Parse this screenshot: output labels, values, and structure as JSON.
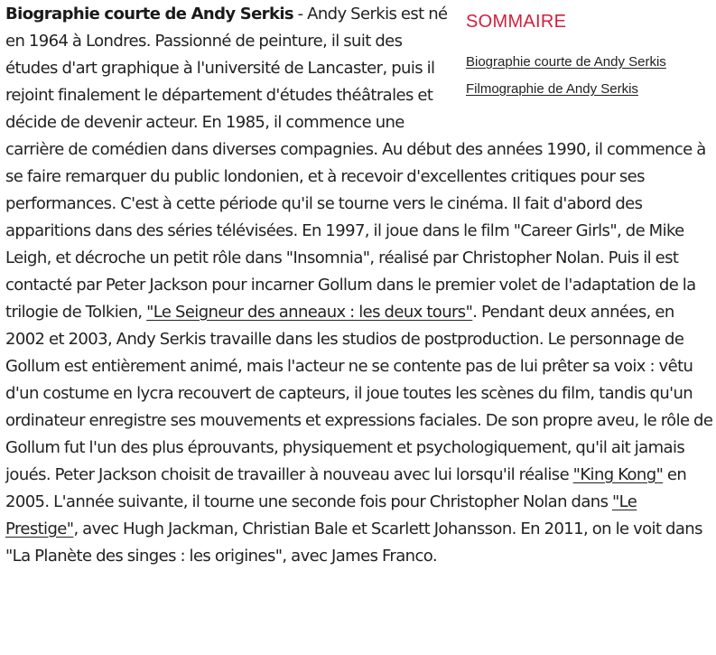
{
  "toc": {
    "title": "SOMMAIRE",
    "items": [
      {
        "label": "Biographie courte de Andy Serkis"
      },
      {
        "label": "Filmographie de Andy Serkis"
      }
    ]
  },
  "article": {
    "heading": "Biographie courte de Andy Serkis",
    "separator": " - ",
    "p1": "Andy Serkis est né en 1964 à Londres. Passionné de peinture, il suit des études d'art graphique à l'université de Lancaster, puis il rejoint finalement le département d'études théâtrales et décide de devenir acteur. En 1985, il commence une carrière de comédien dans diverses compagnies. Au début des années 1990, il commence à se faire remarquer du public londonien, et à recevoir d'excellentes critiques pour ses performances. C'est à cette période qu'il se tourne vers le cinéma. Il fait d'abord des apparitions dans des séries télévisées. En 1997, il joue dans le film \"Career Girls\", de Mike Leigh, et décroche un petit rôle dans \"Insomnia\", réalisé par Christopher Nolan. Puis il est contacté par Peter Jackson pour incarner Gollum dans le premier volet de l'adaptation de la trilogie de Tolkien, ",
    "link1": "\"Le Seigneur des anneaux : les deux tours\"",
    "p2": ". Pendant deux années, en 2002 et 2003, Andy Serkis travaille dans les studios de postproduction. Le personnage de Gollum est entièrement animé, mais l'acteur ne se contente pas de lui prêter sa voix : vêtu d'un costume en lycra recouvert de capteurs, il joue toutes les scènes du film, tandis qu'un ordinateur enregistre ses mouvements et expressions faciales. De son propre aveu, le rôle de Gollum fut l'un des plus éprouvants, physiquement et psychologiquement, qu'il ait jamais joués. Peter Jackson choisit de travailler à nouveau avec lui lorsqu'il réalise ",
    "link2": "\"King Kong\"",
    "p3": " en 2005. L'année suivante, il tourne une seconde fois pour Christopher Nolan dans ",
    "link3": "\"Le Prestige\"",
    "p4": ", avec Hugh Jackman, Christian Bale et Scarlett Johansson. En 2011, on le voit dans \"La Planète des singes : les origines\", avec James Franco."
  }
}
